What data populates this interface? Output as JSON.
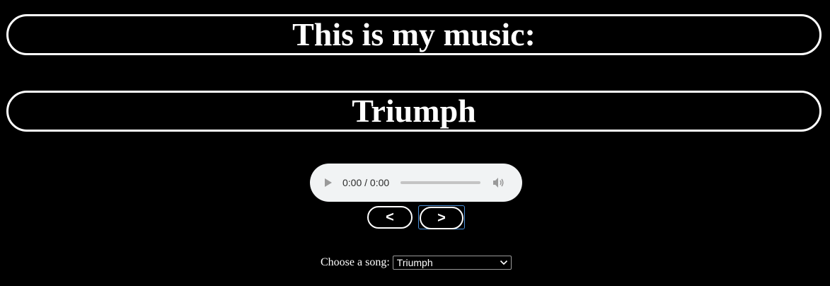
{
  "header": {
    "title": "This is my music:",
    "current_song": "Triumph"
  },
  "player": {
    "time_display": "0:00 / 0:00",
    "play_icon": "play-icon",
    "volume_icon": "volume-icon",
    "progress": 0
  },
  "controls": {
    "prev_label": "<",
    "next_label": ">"
  },
  "chooser": {
    "label": "Choose a song:",
    "selected": "Triumph"
  },
  "colors": {
    "background": "#000000",
    "foreground": "#ffffff",
    "player_bg": "#f1f3f4",
    "focus_ring": "#4a90d9"
  }
}
